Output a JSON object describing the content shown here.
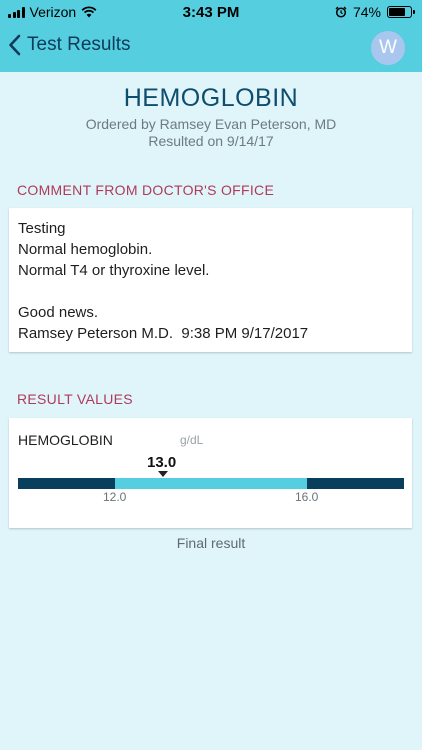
{
  "status_bar": {
    "carrier": "Verizon",
    "time": "3:43 PM",
    "battery": "74%"
  },
  "nav": {
    "back_label": "Test Results",
    "avatar_initial": "W"
  },
  "test": {
    "title": "HEMOGLOBIN",
    "ordered_by": "Ordered by Ramsey Evan Peterson, MD",
    "resulted_on": "Resulted on 9/14/17"
  },
  "comment": {
    "header": "COMMENT FROM DOCTOR'S OFFICE",
    "lines": [
      "Testing",
      "Normal hemoglobin.",
      "Normal T4 or thyroxine level.",
      "",
      "Good news.",
      "Ramsey Peterson M.D.  9:38 PM 9/17/2017"
    ]
  },
  "results": {
    "header": "RESULT VALUES",
    "items": [
      {
        "name": "HEMOGLOBIN",
        "unit": "g/dL",
        "value": "13.0",
        "low": "12.0",
        "high": "16.0"
      }
    ],
    "status": "Final result"
  },
  "colors": {
    "header_bg": "#55cfe0",
    "page_bg": "#dff5f9",
    "title": "#0f4d6e",
    "section_label": "#b03a5b",
    "range_out": "#0a3e5d",
    "range_in": "#55cfe0"
  }
}
